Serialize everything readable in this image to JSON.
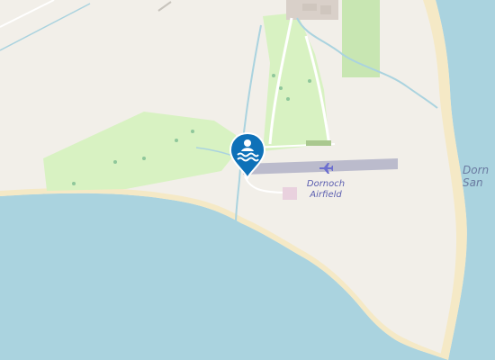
{
  "map": {
    "labels": {
      "airfield_line1": "Dornoch",
      "airfield_line2": "Airfield",
      "place_line1": "Dorn",
      "place_line2": "San"
    },
    "icons": {
      "airport": "airplane-icon",
      "marker": "swimming-marker-icon"
    },
    "colors": {
      "land": "#f2efe9",
      "water": "#aad3df",
      "sand": "#f5e9c6",
      "park": "#d8f2c2",
      "golf": "#c8e6b2",
      "runway": "#bbbbcc",
      "apron": "#e9d1de",
      "marker": "#0e71b8",
      "label": "#4a4fa6"
    }
  }
}
